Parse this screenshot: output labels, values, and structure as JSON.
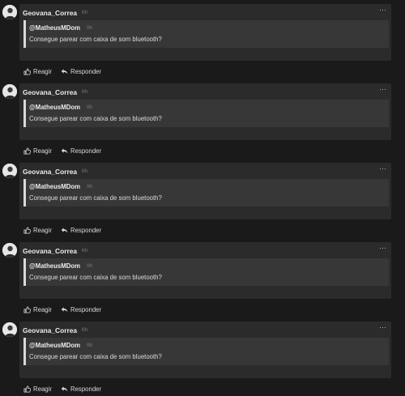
{
  "comments": [
    {
      "author": "Geovana_Correa",
      "time": "6h",
      "menu": "···",
      "quote": {
        "user": "@MatheusMDom",
        "time": "9h",
        "text": "Consegue parear com caixa de som bluetooth?"
      },
      "actions": {
        "react": "Reagir",
        "reply": "Responder"
      }
    },
    {
      "author": "Geovana_Correa",
      "time": "6h",
      "menu": "···",
      "quote": {
        "user": "@MatheusMDom",
        "time": "9h",
        "text": "Consegue parear com caixa de som bluetooth?"
      },
      "actions": {
        "react": "Reagir",
        "reply": "Responder"
      }
    },
    {
      "author": "Geovana_Correa",
      "time": "6h",
      "menu": "···",
      "quote": {
        "user": "@MatheusMDom",
        "time": "9h",
        "text": "Consegue parear com caixa de som bluetooth?"
      },
      "actions": {
        "react": "Reagir",
        "reply": "Responder"
      }
    },
    {
      "author": "Geovana_Correa",
      "time": "6h",
      "menu": "···",
      "quote": {
        "user": "@MatheusMDom",
        "time": "9h",
        "text": "Consegue parear com caixa de som bluetooth?"
      },
      "actions": {
        "react": "Reagir",
        "reply": "Responder"
      }
    },
    {
      "author": "Geovana_Correa",
      "time": "6h",
      "menu": "···",
      "quote": {
        "user": "@MatheusMDom",
        "time": "9h",
        "text": "Consegue parear com caixa de som bluetooth?"
      },
      "actions": {
        "react": "Reagir",
        "reply": "Responder"
      }
    }
  ],
  "icons": {
    "avatar": "avatar-icon",
    "menu": "more-options-icon",
    "react": "thumbs-up-icon",
    "reply": "reply-arrow-icon"
  },
  "colors": {
    "background": "#1a1a1a",
    "card": "#2b2b2b",
    "quote": "#373737",
    "quote_bar": "#d9d9d9",
    "muted_text": "#777777"
  }
}
